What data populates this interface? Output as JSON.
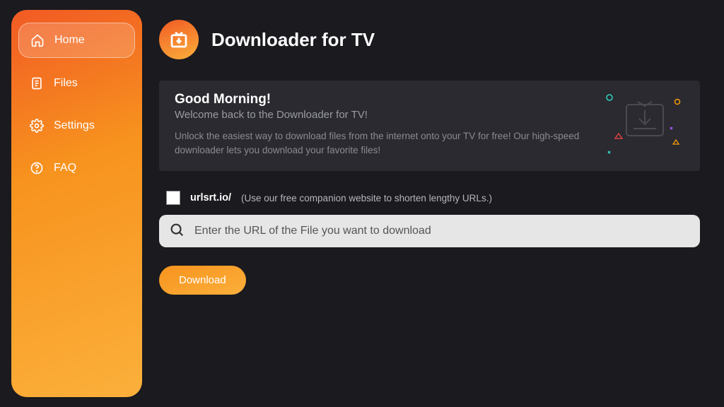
{
  "app": {
    "title": "Downloader for TV"
  },
  "sidebar": {
    "items": [
      {
        "label": "Home"
      },
      {
        "label": "Files"
      },
      {
        "label": "Settings"
      },
      {
        "label": "FAQ"
      }
    ]
  },
  "welcome": {
    "greeting": "Good Morning!",
    "subtitle": "Welcome back to the Downloader for TV!",
    "description": "Unlock the easiest way to download files from the internet onto your TV for free! Our high-speed downloader lets you download your favorite files!"
  },
  "shorten": {
    "label": "urlsrt.io/",
    "hint": "(Use our free companion website to shorten lengthy URLs.)",
    "checked": false
  },
  "url_input": {
    "placeholder": "Enter the URL of the File you want to download",
    "value": ""
  },
  "download_button": {
    "label": "Download"
  }
}
